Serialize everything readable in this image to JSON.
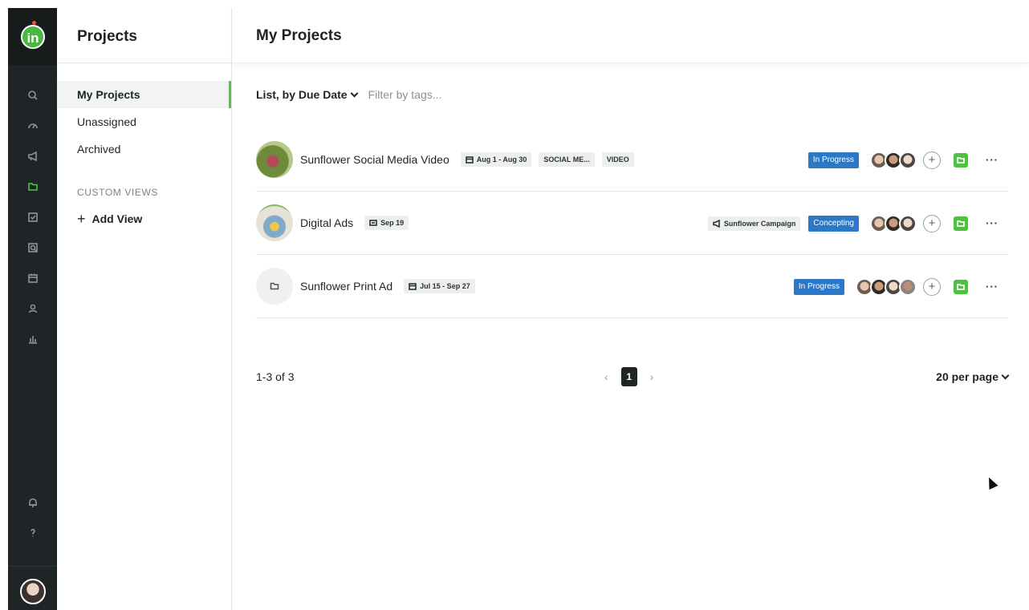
{
  "rail": {
    "logo_text": "in",
    "icons": [
      "search-icon",
      "dashboard-icon",
      "megaphone-icon",
      "folder-icon",
      "tasks-icon",
      "review-icon",
      "calendar-icon",
      "people-icon",
      "reports-icon",
      "notifications-icon",
      "help-icon"
    ]
  },
  "panel": {
    "title": "Projects",
    "items": [
      {
        "label": "My Projects",
        "active": true
      },
      {
        "label": "Unassigned",
        "active": false
      },
      {
        "label": "Archived",
        "active": false
      }
    ],
    "custom_views_label": "CUSTOM VIEWS",
    "add_view_label": "Add View",
    "add_view_plus": "+"
  },
  "main": {
    "title": "My Projects",
    "sort_label": "List, by Due Date",
    "filter_placeholder": "Filter by tags...",
    "projects": [
      {
        "name": "Sunflower Social Media Video",
        "date": "Aug 1 - Aug 30",
        "tags": [
          "SOCIAL ME...",
          "VIDEO"
        ],
        "campaign": "",
        "status": "In Progress"
      },
      {
        "name": "Digital Ads",
        "date": "Sep 19",
        "tags": [],
        "campaign": "Sunflower Campaign",
        "status": "Concepting"
      },
      {
        "name": "Sunflower Print Ad",
        "date": "Jul 15 - Sep 27",
        "tags": [],
        "campaign": "",
        "status": "In Progress"
      }
    ],
    "add_member": "+",
    "more": "···",
    "pager": {
      "count": "1-3 of 3",
      "prev": "‹",
      "current": "1",
      "next": "›",
      "per_page": "20 per page"
    }
  },
  "colors": {
    "rail_bg": "#1f2426",
    "accent_green": "#55c343",
    "status_blue": "#2c78c8"
  }
}
